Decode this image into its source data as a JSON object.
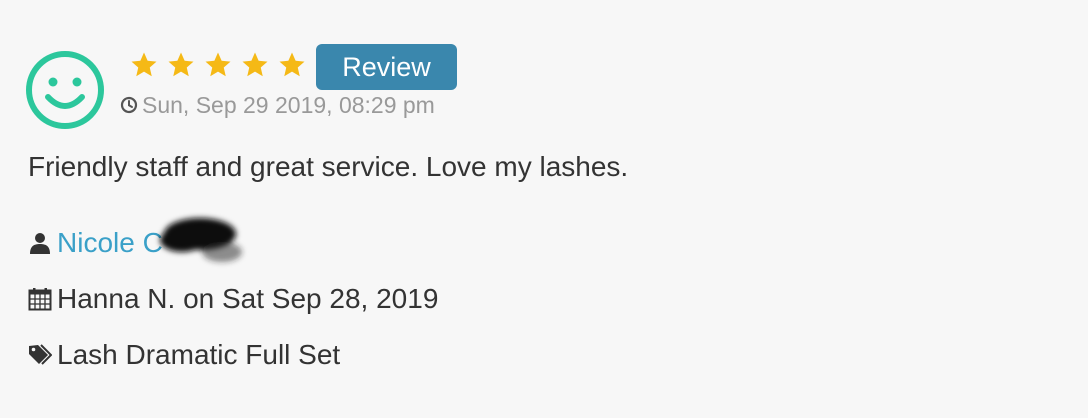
{
  "review": {
    "rating": 5,
    "rating_max": 5,
    "badge_label": "Review",
    "timestamp": "Sun, Sep 29 2019, 08:29 pm",
    "text": "Friendly staff and great service. Love my lashes.",
    "reviewer_name": "Nicole C",
    "appointment": "Hanna N. on Sat Sep 28, 2019",
    "service": "Lash Dramatic Full Set"
  },
  "colors": {
    "avatar": "#2cc79c",
    "star": "#f5b916",
    "badge_bg": "#3a87ad",
    "link": "#3aa0c8",
    "meta_text": "#999999",
    "body_text": "#333333"
  },
  "icons": {
    "avatar": "smiley-face-icon",
    "star": "star-icon",
    "time": "clock-icon",
    "user": "user-icon",
    "date": "calendar-icon",
    "service": "tag-icon"
  }
}
